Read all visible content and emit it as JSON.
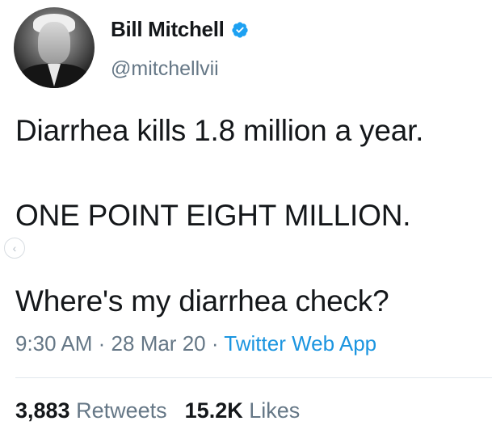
{
  "tweet": {
    "author_name": "Bill Mitchell",
    "author_handle": "@mitchellvii",
    "lines": [
      "Diarrhea kills 1.8 million a year.",
      "ONE POINT EIGHT MILLION.",
      "Where's my diarrhea check?"
    ],
    "time": "9:30 AM",
    "date": "28 Mar 20",
    "separator": "·",
    "source": "Twitter Web App",
    "retweets_count": "3,883",
    "retweets_label": "Retweets",
    "likes_count": "15.2K",
    "likes_label": "Likes"
  },
  "icons": {
    "verified": "verified-badge-icon",
    "nav": "chevron-left-icon"
  },
  "colors": {
    "verified_blue": "#1da1f2",
    "link_blue": "#1b95e0",
    "secondary_text": "#657786"
  }
}
